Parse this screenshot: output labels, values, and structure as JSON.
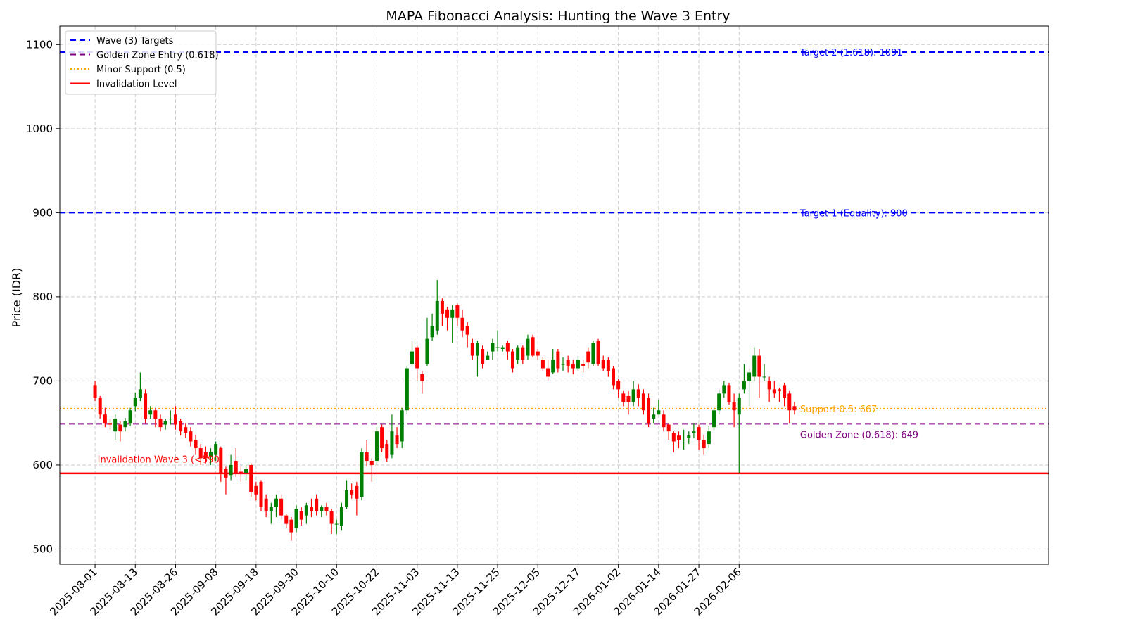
{
  "chart_data": {
    "type": "candlestick",
    "title": "MAPA Fibonacci Analysis: Hunting the Wave 3 Entry",
    "xlabel": "",
    "ylabel": "Price (IDR)",
    "ylim": [
      482,
      1122
    ],
    "y_ticks": [
      500,
      600,
      700,
      800,
      900,
      1000,
      1100
    ],
    "x_ticks": [
      "2025-08-01",
      "2025-08-13",
      "2025-08-26",
      "2025-09-08",
      "2025-09-18",
      "2025-09-30",
      "2025-10-10",
      "2025-10-22",
      "2025-11-03",
      "2025-11-13",
      "2025-11-25",
      "2025-12-05",
      "2025-12-17",
      "2026-01-02",
      "2026-01-14",
      "2026-01-27",
      "2026-02-06"
    ],
    "x_tick_index_step": 8,
    "x_range_index": [
      -7,
      189.5
    ],
    "grid": true,
    "legend_position": "top-left",
    "colors": {
      "up": "#008000",
      "down": "#ff0000"
    },
    "levels": [
      {
        "key": "target2",
        "value": 1091,
        "color": "#0000ff",
        "style": "dashed",
        "label": "Target 2 (1.618): 1091"
      },
      {
        "key": "target1",
        "value": 900,
        "color": "#0000ff",
        "style": "dashed",
        "label": "Target 1 (Equality): 900"
      },
      {
        "key": "support",
        "value": 667,
        "color": "#ffa500",
        "style": "dotted",
        "label": "Support 0.5: 667"
      },
      {
        "key": "golden",
        "value": 649,
        "color": "#800080",
        "style": "dashed",
        "label": "Golden Zone (0.618): 649"
      },
      {
        "key": "invalid",
        "value": 590,
        "color": "#ff0000",
        "style": "solid",
        "label": ""
      }
    ],
    "annotations": [
      {
        "text": "Invalidation Wave 3 (<590)",
        "x_index": 0.5,
        "y": 603,
        "color": "#ff0000"
      }
    ],
    "legend": [
      {
        "name": "Wave (3) Targets",
        "color": "#0000ff",
        "style": "dashed"
      },
      {
        "name": "Golden Zone Entry (0.618)",
        "color": "#800080",
        "style": "dashed"
      },
      {
        "name": "Minor Support (0.5)",
        "color": "#ffa500",
        "style": "dotted"
      },
      {
        "name": "Invalidation Level",
        "color": "#ff0000",
        "style": "solid"
      }
    ],
    "candles": [
      [
        695,
        680,
        700,
        676
      ],
      [
        680,
        660,
        682,
        655
      ],
      [
        660,
        650,
        668,
        645
      ],
      [
        650,
        648,
        655,
        642
      ],
      [
        640,
        655,
        660,
        630
      ],
      [
        648,
        640,
        652,
        628
      ],
      [
        645,
        652,
        656,
        640
      ],
      [
        650,
        665,
        668,
        646
      ],
      [
        670,
        680,
        686,
        664
      ],
      [
        680,
        690,
        710,
        676
      ],
      [
        685,
        655,
        690,
        650
      ],
      [
        660,
        665,
        670,
        655
      ],
      [
        665,
        655,
        668,
        645
      ],
      [
        655,
        645,
        660,
        640
      ],
      [
        648,
        652,
        655,
        642
      ],
      [
        655,
        655,
        665,
        648
      ],
      [
        660,
        648,
        670,
        642
      ],
      [
        652,
        640,
        655,
        635
      ],
      [
        645,
        638,
        650,
        632
      ],
      [
        640,
        628,
        645,
        622
      ],
      [
        630,
        620,
        636,
        612
      ],
      [
        620,
        608,
        625,
        600
      ],
      [
        615,
        608,
        622,
        602
      ],
      [
        610,
        615,
        620,
        600
      ],
      [
        612,
        625,
        628,
        605
      ],
      [
        620,
        590,
        622,
        580
      ],
      [
        595,
        585,
        598,
        565
      ],
      [
        588,
        600,
        612,
        582
      ],
      [
        605,
        590,
        620,
        586
      ],
      [
        592,
        590,
        598,
        580
      ],
      [
        590,
        595,
        600,
        582
      ],
      [
        600,
        568,
        602,
        562
      ],
      [
        575,
        565,
        580,
        558
      ],
      [
        580,
        550,
        582,
        545
      ],
      [
        560,
        545,
        565,
        538
      ],
      [
        545,
        550,
        555,
        530
      ],
      [
        550,
        560,
        565,
        538
      ],
      [
        560,
        540,
        565,
        535
      ],
      [
        540,
        530,
        542,
        525
      ],
      [
        535,
        520,
        538,
        510
      ],
      [
        525,
        548,
        552,
        520
      ],
      [
        545,
        535,
        550,
        528
      ],
      [
        540,
        552,
        555,
        530
      ],
      [
        550,
        545,
        560,
        538
      ],
      [
        560,
        545,
        565,
        540
      ],
      [
        545,
        550,
        552,
        538
      ],
      [
        550,
        545,
        555,
        540
      ],
      [
        545,
        530,
        548,
        518
      ],
      [
        530,
        530,
        535,
        518
      ],
      [
        528,
        550,
        555,
        522
      ],
      [
        550,
        570,
        582,
        548
      ],
      [
        570,
        565,
        578,
        560
      ],
      [
        575,
        560,
        580,
        540
      ],
      [
        562,
        615,
        620,
        558
      ],
      [
        615,
        605,
        630,
        598
      ],
      [
        605,
        600,
        608,
        580
      ],
      [
        605,
        640,
        645,
        600
      ],
      [
        645,
        620,
        648,
        615
      ],
      [
        625,
        608,
        630,
        604
      ],
      [
        612,
        640,
        660,
        608
      ],
      [
        635,
        625,
        645,
        620
      ],
      [
        628,
        665,
        668,
        620
      ],
      [
        665,
        715,
        718,
        660
      ],
      [
        720,
        735,
        748,
        718
      ],
      [
        740,
        715,
        742,
        700
      ],
      [
        708,
        700,
        712,
        685
      ],
      [
        720,
        750,
        775,
        718
      ],
      [
        752,
        765,
        780,
        748
      ],
      [
        760,
        795,
        820,
        755
      ],
      [
        795,
        780,
        798,
        765
      ],
      [
        785,
        775,
        788,
        760
      ],
      [
        775,
        785,
        790,
        745
      ],
      [
        790,
        775,
        792,
        765
      ],
      [
        775,
        760,
        785,
        752
      ],
      [
        765,
        755,
        770,
        740
      ],
      [
        745,
        730,
        750,
        725
      ],
      [
        730,
        745,
        748,
        705
      ],
      [
        738,
        720,
        742,
        715
      ],
      [
        725,
        730,
        735,
        725
      ],
      [
        735,
        745,
        750,
        725
      ],
      [
        740,
        740,
        760,
        735
      ],
      [
        738,
        740,
        742,
        735
      ],
      [
        745,
        735,
        748,
        725
      ],
      [
        735,
        715,
        738,
        710
      ],
      [
        725,
        740,
        742,
        720
      ],
      [
        740,
        725,
        742,
        720
      ],
      [
        730,
        750,
        755,
        725
      ],
      [
        752,
        730,
        755,
        728
      ],
      [
        735,
        730,
        738,
        725
      ],
      [
        725,
        715,
        728,
        712
      ],
      [
        715,
        705,
        725,
        700
      ],
      [
        710,
        725,
        738,
        708
      ],
      [
        735,
        715,
        738,
        710
      ],
      [
        720,
        720,
        728,
        712
      ],
      [
        725,
        718,
        730,
        710
      ],
      [
        720,
        715,
        725,
        708
      ],
      [
        715,
        725,
        730,
        712
      ],
      [
        720,
        718,
        725,
        710
      ],
      [
        735,
        722,
        740,
        715
      ],
      [
        720,
        745,
        748,
        718
      ],
      [
        748,
        720,
        750,
        718
      ],
      [
        725,
        715,
        730,
        712
      ],
      [
        725,
        712,
        728,
        705
      ],
      [
        715,
        695,
        718,
        690
      ],
      [
        700,
        690,
        702,
        680
      ],
      [
        685,
        675,
        688,
        670
      ],
      [
        682,
        675,
        688,
        660
      ],
      [
        675,
        690,
        700,
        670
      ],
      [
        690,
        680,
        696,
        670
      ],
      [
        685,
        665,
        690,
        660
      ],
      [
        680,
        650,
        685,
        645
      ],
      [
        655,
        660,
        668,
        650
      ],
      [
        660,
        665,
        678,
        660
      ],
      [
        660,
        645,
        665,
        640
      ],
      [
        648,
        640,
        650,
        630
      ],
      [
        638,
        628,
        640,
        615
      ],
      [
        635,
        630,
        640,
        620
      ],
      [
        630,
        630,
        642,
        618
      ],
      [
        632,
        635,
        640,
        625
      ],
      [
        638,
        640,
        650,
        632
      ],
      [
        645,
        630,
        648,
        618
      ],
      [
        630,
        620,
        636,
        612
      ],
      [
        625,
        640,
        646,
        620
      ],
      [
        645,
        665,
        670,
        640
      ],
      [
        665,
        685,
        690,
        660
      ],
      [
        685,
        695,
        700,
        680
      ],
      [
        695,
        675,
        698,
        672
      ],
      [
        675,
        665,
        685,
        645
      ],
      [
        660,
        680,
        685,
        590
      ],
      [
        690,
        700,
        720,
        685
      ],
      [
        700,
        710,
        715,
        670
      ],
      [
        705,
        730,
        740,
        700
      ],
      [
        730,
        705,
        738,
        680
      ],
      [
        705,
        705,
        720,
        700
      ],
      [
        700,
        690,
        705,
        675
      ],
      [
        690,
        685,
        700,
        680
      ],
      [
        690,
        688,
        692,
        675
      ],
      [
        695,
        680,
        698,
        670
      ],
      [
        685,
        665,
        688,
        650
      ],
      [
        670,
        665,
        675,
        660
      ]
    ]
  }
}
